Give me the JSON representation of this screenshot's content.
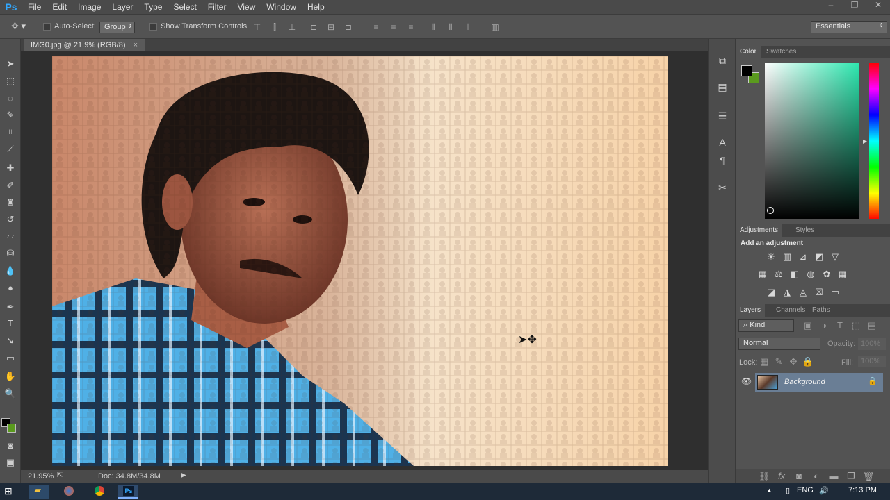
{
  "app": {
    "logo": "Ps"
  },
  "menu": [
    "File",
    "Edit",
    "Image",
    "Layer",
    "Type",
    "Select",
    "Filter",
    "View",
    "Window",
    "Help"
  ],
  "window_controls": [
    "–",
    "❐",
    "✕"
  ],
  "options": {
    "auto_select_label": "Auto-Select:",
    "auto_select_value": "Group",
    "show_transform_label": "Show Transform Controls",
    "workspace": "Essentials"
  },
  "document": {
    "tab_title": "IMG0.jpg @ 21.9% (RGB/8)",
    "tab_close": "×",
    "zoom": "21.95%",
    "doc_size": "Doc: 34.8M/34.8M"
  },
  "color_panel": {
    "tabs": [
      "Color",
      "Swatches"
    ],
    "foreground": "#000000",
    "background": "#5a9a1e",
    "hue_color": "#2ee8b0"
  },
  "adjustments_panel": {
    "tabs": [
      "Adjustments",
      "Styles"
    ],
    "heading": "Add an adjustment"
  },
  "layers_panel": {
    "tabs": [
      "Layers",
      "Channels",
      "Paths"
    ],
    "filter_kind": "Kind",
    "blend_mode": "Normal",
    "opacity_label": "Opacity:",
    "opacity_value": "100%",
    "lock_label": "Lock:",
    "fill_label": "Fill:",
    "fill_value": "100%",
    "layers": [
      {
        "name": "Background",
        "visible": true,
        "locked": true
      }
    ]
  },
  "taskbar": {
    "language": "ENG",
    "time": "7:13 PM"
  }
}
